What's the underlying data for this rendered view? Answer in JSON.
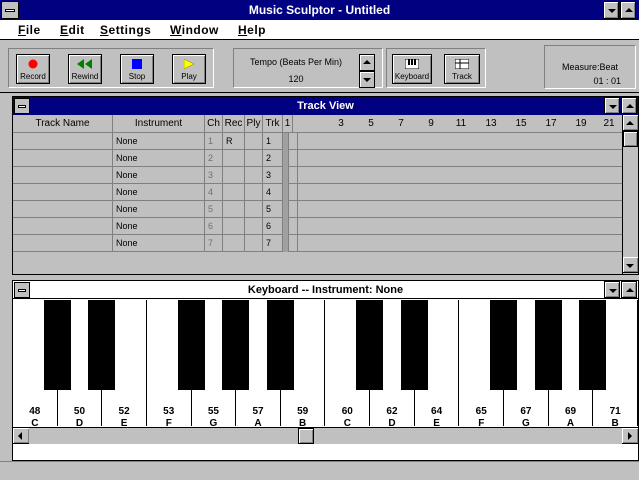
{
  "app": {
    "title": "Music Sculptor - Untitled"
  },
  "menu": {
    "items": [
      {
        "key": "F",
        "rest": "ile"
      },
      {
        "key": "E",
        "rest": "dit"
      },
      {
        "key": "S",
        "rest": "ettings"
      },
      {
        "key": "W",
        "rest": "indow"
      },
      {
        "key": "H",
        "rest": "elp"
      }
    ]
  },
  "toolbar": {
    "record_label": "Record",
    "rewind_label": "Rewind",
    "stop_label": "Stop",
    "play_label": "Play",
    "tempo_label": "Tempo (Beats Per Min)",
    "tempo_value": "120",
    "keyboard_label": "Keyboard",
    "track_label": "Track",
    "measure_label": "Measure:Beat",
    "measure_value": "01 : 01",
    "colors": {
      "record": "#ff0000",
      "rewind": "#008000",
      "stop": "#0000ff",
      "play": "#ffff00"
    }
  },
  "trackview": {
    "title": "Track View",
    "headers": [
      "Track Name",
      "Instrument",
      "Ch",
      "Rec",
      "Ply",
      "Trk",
      "1",
      "3",
      "5",
      "7",
      "9",
      "11",
      "13",
      "15",
      "17",
      "19",
      "21"
    ],
    "rows": [
      {
        "name": "",
        "instrument": "None",
        "ch": "1",
        "rec": "R",
        "ply": "",
        "trk": "1"
      },
      {
        "name": "",
        "instrument": "None",
        "ch": "2",
        "rec": "",
        "ply": "",
        "trk": "2"
      },
      {
        "name": "",
        "instrument": "None",
        "ch": "3",
        "rec": "",
        "ply": "",
        "trk": "3"
      },
      {
        "name": "",
        "instrument": "None",
        "ch": "4",
        "rec": "",
        "ply": "",
        "trk": "4"
      },
      {
        "name": "",
        "instrument": "None",
        "ch": "5",
        "rec": "",
        "ply": "",
        "trk": "5"
      },
      {
        "name": "",
        "instrument": "None",
        "ch": "6",
        "rec": "",
        "ply": "",
        "trk": "6"
      },
      {
        "name": "",
        "instrument": "None",
        "ch": "7",
        "rec": "",
        "ply": "",
        "trk": "7"
      }
    ]
  },
  "keyboard": {
    "title": "Keyboard -- Instrument: None",
    "white_keys": [
      {
        "num": "48",
        "note": "C"
      },
      {
        "num": "50",
        "note": "D"
      },
      {
        "num": "52",
        "note": "E"
      },
      {
        "num": "53",
        "note": "F"
      },
      {
        "num": "55",
        "note": "G"
      },
      {
        "num": "57",
        "note": "A"
      },
      {
        "num": "59",
        "note": "B"
      },
      {
        "num": "60",
        "note": "C"
      },
      {
        "num": "62",
        "note": "D"
      },
      {
        "num": "64",
        "note": "E"
      },
      {
        "num": "65",
        "note": "F"
      },
      {
        "num": "67",
        "note": "G"
      },
      {
        "num": "69",
        "note": "A"
      },
      {
        "num": "71",
        "note": "B"
      }
    ]
  }
}
